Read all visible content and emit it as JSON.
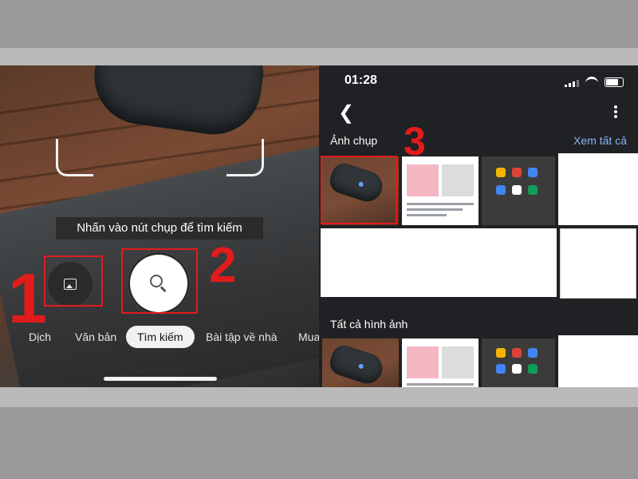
{
  "camera": {
    "hint": "Nhấn vào nút chụp để tìm kiếm",
    "modes": [
      "Dịch",
      "Văn bản",
      "Tìm kiếm",
      "Bài tập về nhà",
      "Mua"
    ],
    "active_mode": "Tìm kiếm"
  },
  "annotations": {
    "step1": "1",
    "step2": "2",
    "step3": "3",
    "color": "#e21b1b"
  },
  "gallery": {
    "status": {
      "time": "01:28"
    },
    "section_photos": "Ảnh chụp",
    "see_all": "Xem tất cả",
    "section_all": "Tất cả hình ảnh",
    "accent": "#8ab4f8"
  },
  "icons": {
    "gallery": "image-icon",
    "shutter": "search-icon",
    "back": "back-arrow-icon",
    "more": "more-vert-icon"
  }
}
